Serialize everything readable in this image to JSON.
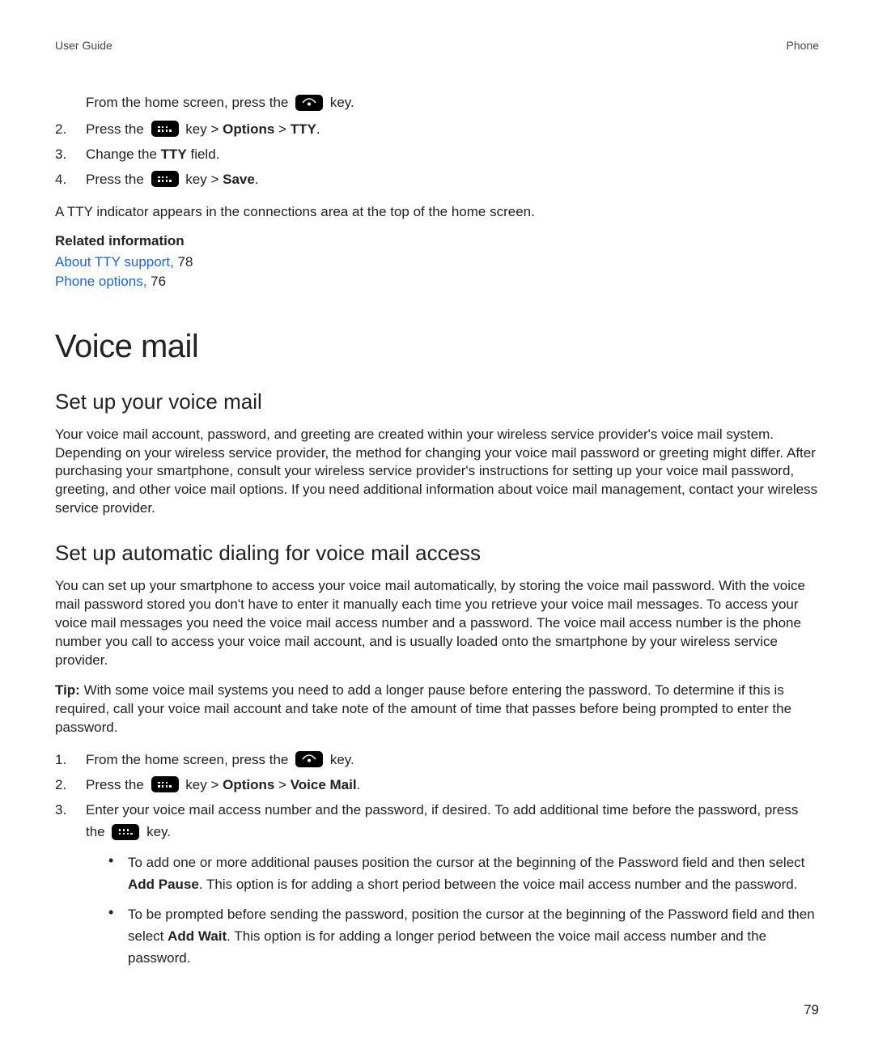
{
  "header": {
    "left": "User Guide",
    "right": "Phone"
  },
  "intro": {
    "line1_pre": "From the home screen, press the ",
    "line1_post": " key.",
    "step2_pre": "Press the ",
    "step2_mid": " key > ",
    "step2_b1": "Options",
    "step2_sep": " > ",
    "step2_b2": "TTY",
    "step2_end": ".",
    "step3_pre": "Change the ",
    "step3_b": "TTY",
    "step3_post": " field.",
    "step4_pre": "Press the ",
    "step4_mid": " key > ",
    "step4_b": "Save",
    "step4_end": ".",
    "num2": "2.",
    "num3": "3.",
    "num4": "4."
  },
  "indicator_para": "A TTY indicator appears in the connections area at the top of the home screen.",
  "related": {
    "title": "Related information",
    "link1_text": "About TTY support,",
    "link1_page": " 78",
    "link2_text": "Phone options,",
    "link2_page": " 76"
  },
  "section": {
    "title": "Voice mail"
  },
  "sub1": {
    "title": "Set up your voice mail",
    "para": "Your voice mail account, password, and greeting are created within your wireless service provider's voice mail system. Depending on your wireless service provider, the method for changing your voice mail password or greeting might differ. After purchasing your smartphone, consult your wireless service provider's instructions for setting up your voice mail password, greeting, and other voice mail options. If you need additional information about voice mail management, contact your wireless service provider."
  },
  "sub2": {
    "title": "Set up automatic dialing for voice mail access",
    "para1": "You can set up your smartphone to access your voice mail automatically, by storing the voice mail password. With the voice mail password stored you don't have to enter it manually each time you retrieve your voice mail messages. To access your voice mail messages you need the voice mail access number and a password. The voice mail access number is the phone number you call to access your voice mail account, and is usually loaded onto the smartphone by your wireless service provider.",
    "tip_label": "Tip:",
    "tip_text": " With some voice mail systems you need to add a longer pause before entering the password. To determine if this is required, call your voice mail account and take note of the amount of time that passes before being prompted to enter the password.",
    "steps": {
      "num1": "1.",
      "num2": "2.",
      "num3": "3.",
      "s1_pre": "From the home screen, press the ",
      "s1_post": " key.",
      "s2_pre": "Press the ",
      "s2_mid": " key > ",
      "s2_b1": "Options",
      "s2_sep": " > ",
      "s2_b2": "Voice Mail",
      "s2_end": ".",
      "s3_pre": "Enter your voice mail access number and the password, if desired. To add additional time before the password, press the ",
      "s3_post": " key.",
      "b1_pre": "To add one or more additional pauses position the cursor at the beginning of the Password field and then select ",
      "b1_b": "Add Pause",
      "b1_post": ". This option is for adding a short period between the voice mail access number and the password.",
      "b2_pre": "To be prompted before sending the password, position the cursor at the beginning of the Password field and then select ",
      "b2_b": "Add Wait",
      "b2_post": ". This option is for adding a longer period between the voice mail access number and the password."
    }
  },
  "page_number": "79"
}
